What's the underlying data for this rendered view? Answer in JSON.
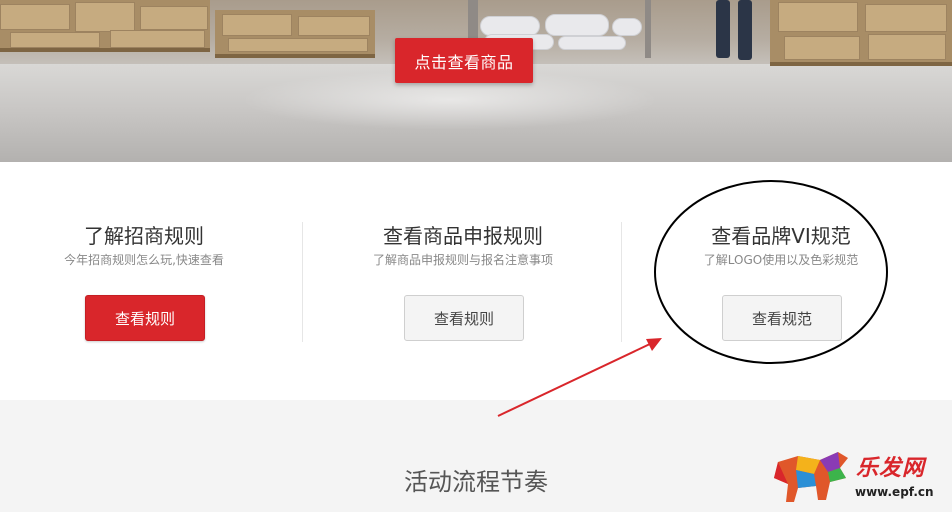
{
  "hero": {
    "cta_label": "点击查看商品"
  },
  "columns": [
    {
      "title": "了解招商规则",
      "subtitle": "今年招商规则怎么玩,快速查看",
      "button_label": "查看规则"
    },
    {
      "title": "查看商品申报规则",
      "subtitle": "了解商品申报规则与报名注意事项",
      "button_label": "查看规则"
    },
    {
      "title": "查看品牌VI规范",
      "subtitle": "了解LOGO使用以及色彩规范",
      "button_label": "查看规范"
    }
  ],
  "lower": {
    "title": "活动流程节奏"
  },
  "watermark": {
    "brand": "乐发网",
    "url": "www.epf.cn"
  },
  "colors": {
    "accent_red": "#d9262b",
    "annotation_arrow": "#d9262b",
    "annotation_circle": "#000000"
  }
}
